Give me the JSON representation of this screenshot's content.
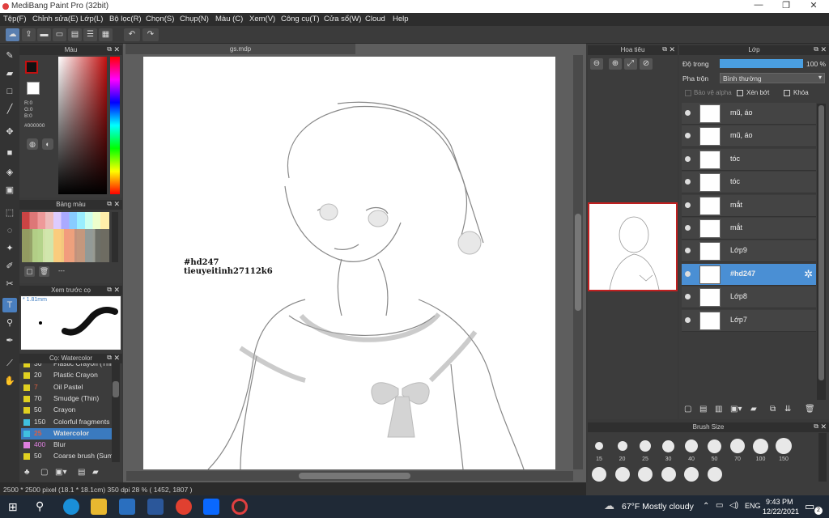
{
  "window": {
    "title": "MediBang Paint Pro (32bit)"
  },
  "menu": [
    "Tệp(F)",
    "Chỉnh sửa(E)",
    "Lớp(L)",
    "Bộ lọc(R)",
    "Chọn(S)",
    "Chụp(N)",
    "Màu (C)",
    "Xem(V)",
    "Công cụ(T)",
    "Cửa sổ(W)",
    "Cloud",
    "Help"
  ],
  "document": {
    "tab": "gs.mdp"
  },
  "color_panel": {
    "title": "Màu",
    "rgb": [
      "R:0",
      "G:0",
      "B:0"
    ],
    "hex": "#000000",
    "main_color": "#c21010"
  },
  "palette_panel": {
    "title": "Bảng màu",
    "more": "---"
  },
  "preview_panel": {
    "title": "Xem trước cọ",
    "size": "1.81mm"
  },
  "brush_panel": {
    "title": "Cọ: Watercolor",
    "items": [
      {
        "num": "30",
        "name": "Plastic Crayon (Thi",
        "color": "#e0d020"
      },
      {
        "num": "20",
        "name": "Plastic Crayon",
        "color": "#e0d020"
      },
      {
        "num": "7",
        "name": "Oil Pastel",
        "color": "#e0d020"
      },
      {
        "num": "70",
        "name": "Smudge (Thin)",
        "color": "#e0d020"
      },
      {
        "num": "50",
        "name": "Crayon",
        "color": "#e0d020"
      },
      {
        "num": "150",
        "name": "Colorful fragments",
        "color": "#40c0e0"
      },
      {
        "num": "25",
        "name": "Watercolor",
        "color": "#40c0e0"
      },
      {
        "num": "400",
        "name": "Blur",
        "color": "#e080e0"
      },
      {
        "num": "50",
        "name": "Coarse brush (Sum",
        "color": "#e0d020"
      }
    ]
  },
  "artwork": {
    "tag_line1": "#hd247",
    "tag_line2": "tieuyeitinh27112k6"
  },
  "navigator": {
    "title": "Hoa tiêu"
  },
  "layer_panel": {
    "title": "Lớp",
    "opacity_label": "Độ trong",
    "opacity_value": "100 %",
    "opacity": 1.0,
    "blend_label": "Pha trộn",
    "blend_value": "Bình thường",
    "protect_alpha": "Bảo vệ alpha",
    "clip": "Xén bớt",
    "lock": "Khóa",
    "layers": [
      {
        "name": "mũ, áo",
        "selected": false
      },
      {
        "name": "mũ, áo",
        "selected": false
      },
      {
        "name": "tóc",
        "selected": false
      },
      {
        "name": "tóc",
        "selected": false
      },
      {
        "name": "mắt",
        "selected": false
      },
      {
        "name": "mắt",
        "selected": false
      },
      {
        "name": "Lớp9",
        "selected": false
      },
      {
        "name": "#hd247",
        "selected": true
      },
      {
        "name": "Lớp8",
        "selected": false
      },
      {
        "name": "Lớp7",
        "selected": false
      }
    ]
  },
  "brush_size_panel": {
    "title": "Brush Size",
    "sizes": [
      "15",
      "20",
      "25",
      "30",
      "40",
      "50",
      "70",
      "100",
      "150"
    ]
  },
  "status": {
    "text": "2500 * 2500 pixel  (18.1 * 18.1cm)  350 dpi  28 %  ( 1452, 1807 )"
  },
  "taskbar": {
    "weather": "67°F  Mostly cloudy",
    "lang": "ENG",
    "time": "9:43 PM",
    "date": "12/22/2021",
    "notif": "2"
  }
}
